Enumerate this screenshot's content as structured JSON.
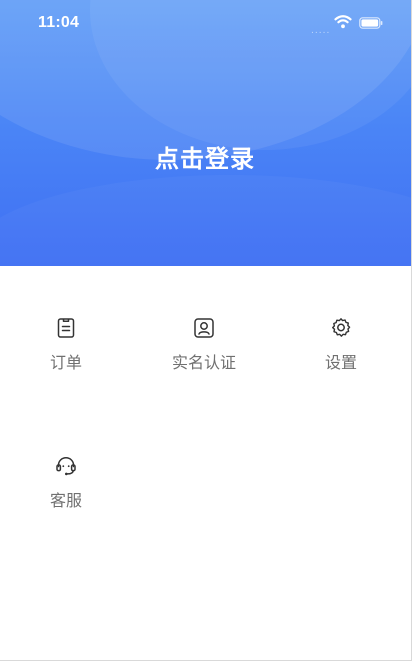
{
  "status_bar": {
    "time": "11:04",
    "signal_dots": "....."
  },
  "header": {
    "login_label": "点击登录"
  },
  "menu": {
    "items": [
      {
        "label": "订单",
        "icon": "order-icon"
      },
      {
        "label": "实名认证",
        "icon": "id-card-icon"
      },
      {
        "label": "设置",
        "icon": "gear-icon"
      },
      {
        "label": "客服",
        "icon": "headset-icon"
      }
    ]
  },
  "colors": {
    "header_top": "#5f9cf7",
    "header_bottom": "#3f6ff3",
    "label_gray": "#707070",
    "icon_dark": "#333333"
  }
}
